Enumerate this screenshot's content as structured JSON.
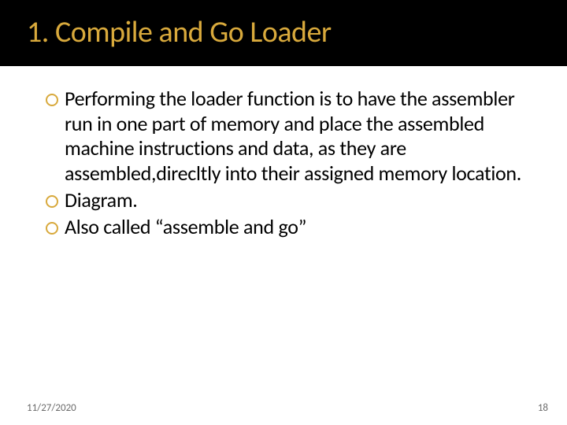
{
  "title": "1. Compile and Go Loader",
  "bullets": [
    "Performing the loader function is to have the assembler run in one part of memory and place the assembled machine instructions and data, as they are assembled,direcltly into their assigned memory location.",
    "Diagram.",
    "Also called “assemble and go”"
  ],
  "footer": {
    "date": "11/27/2020",
    "page": "18"
  }
}
